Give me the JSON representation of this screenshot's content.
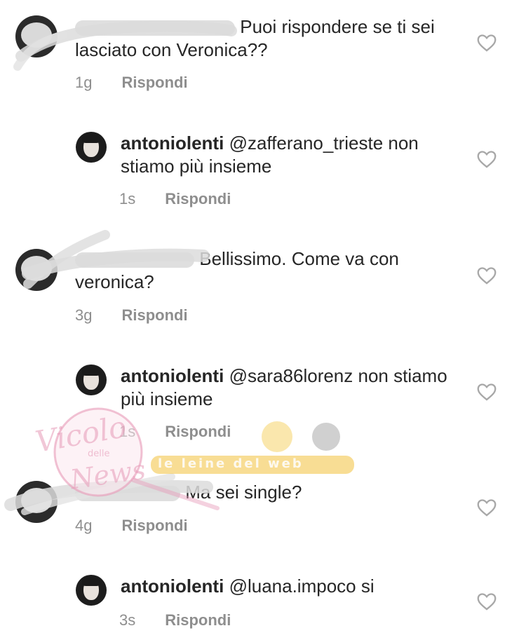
{
  "comments": [
    {
      "username_masked": true,
      "text": "Puoi  rispondere se ti sei lasciato con Veronica??",
      "time": "1g",
      "reply_label": "Rispondi",
      "is_reply": false
    },
    {
      "username": "antoniolenti",
      "text": "@zafferano_trieste non stiamo più insieme",
      "time": "1s",
      "reply_label": "Rispondi",
      "is_reply": true
    },
    {
      "username_masked": true,
      "text": "Bellissimo. Come va con veronica?",
      "time": "3g",
      "reply_label": "Rispondi",
      "is_reply": false
    },
    {
      "username": "antoniolenti",
      "text": "@sara86lorenz non stiamo più insieme",
      "time": "1s",
      "reply_label": "Rispondi",
      "is_reply": true
    },
    {
      "username_masked": true,
      "text": "Ma sei single?",
      "time": "4g",
      "reply_label": "Rispondi",
      "is_reply": false
    },
    {
      "username": "antoniolenti",
      "text": "@luana.impoco si",
      "time": "3s",
      "reply_label": "Rispondi",
      "is_reply": true
    }
  ],
  "watermark": {
    "logo_text_1": "Vicolo",
    "logo_text_2": "delle",
    "logo_text_3": "News",
    "banner_text": "le leine del web"
  },
  "colors": {
    "text": "#262626",
    "meta": "#8e8e8e",
    "heart": "#a8a8a8",
    "watermark_pink": "#e79ab8",
    "watermark_yellow": "#f3c64c"
  },
  "icons": {
    "like": "heart-outline-icon"
  }
}
